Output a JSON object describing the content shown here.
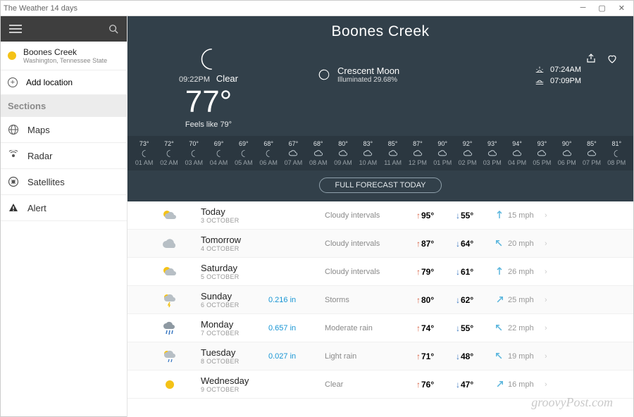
{
  "window": {
    "title": "The Weather 14 days"
  },
  "sidebar": {
    "location": {
      "name": "Boones Creek",
      "region": "Washington, Tennessee State"
    },
    "add_label": "Add location",
    "sections_header": "Sections",
    "items": [
      {
        "label": "Maps",
        "icon": "globe"
      },
      {
        "label": "Radar",
        "icon": "radar"
      },
      {
        "label": "Satellites",
        "icon": "sat"
      },
      {
        "label": "Alert",
        "icon": "alert"
      }
    ]
  },
  "hero": {
    "city": "Boones Creek",
    "time": "09:22PM",
    "condition": "Clear",
    "temp": "77°",
    "feels": "Feels like 79°",
    "moon": {
      "name": "Crescent Moon",
      "illum": "Illuminated 29.68%"
    },
    "sunrise": "07:24AM",
    "sunset": "07:09PM",
    "full_forecast_label": "FULL FORECAST TODAY"
  },
  "hourly": [
    {
      "temp": "73°",
      "icon": "moon",
      "time": "01 AM"
    },
    {
      "temp": "72°",
      "icon": "moon",
      "time": "02 AM"
    },
    {
      "temp": "70°",
      "icon": "moon",
      "time": "03 AM"
    },
    {
      "temp": "69°",
      "icon": "moon",
      "time": "04 AM"
    },
    {
      "temp": "69°",
      "icon": "moon",
      "time": "05 AM"
    },
    {
      "temp": "68°",
      "icon": "moon",
      "time": "06 AM"
    },
    {
      "temp": "67°",
      "icon": "cloud",
      "time": "07 AM"
    },
    {
      "temp": "68°",
      "icon": "cloud",
      "time": "08 AM"
    },
    {
      "temp": "80°",
      "icon": "cloud",
      "time": "09 AM"
    },
    {
      "temp": "83°",
      "icon": "cloud",
      "time": "10 AM"
    },
    {
      "temp": "85°",
      "icon": "cloud",
      "time": "11 AM"
    },
    {
      "temp": "87°",
      "icon": "cloud",
      "time": "12 PM"
    },
    {
      "temp": "90°",
      "icon": "cloud",
      "time": "01 PM"
    },
    {
      "temp": "92°",
      "icon": "cloud",
      "time": "02 PM"
    },
    {
      "temp": "93°",
      "icon": "cloud",
      "time": "03 PM"
    },
    {
      "temp": "94°",
      "icon": "cloud",
      "time": "04 PM"
    },
    {
      "temp": "93°",
      "icon": "cloud",
      "time": "05 PM"
    },
    {
      "temp": "90°",
      "icon": "cloud",
      "time": "06 PM"
    },
    {
      "temp": "85°",
      "icon": "cloud",
      "time": "07 PM"
    },
    {
      "temp": "81°",
      "icon": "moon",
      "time": "08 PM"
    }
  ],
  "daily": [
    {
      "icon": "partly",
      "name": "Today",
      "date": "3 OCTOBER",
      "precip": "",
      "cond": "Cloudy intervals",
      "hi": "95°",
      "lo": "55°",
      "wind": "15 mph",
      "wdir": "N"
    },
    {
      "icon": "cloud",
      "name": "Tomorrow",
      "date": "4 OCTOBER",
      "precip": "",
      "cond": "Cloudy intervals",
      "hi": "87°",
      "lo": "64°",
      "wind": "20 mph",
      "wdir": "NW"
    },
    {
      "icon": "partly",
      "name": "Saturday",
      "date": "5 OCTOBER",
      "precip": "",
      "cond": "Cloudy intervals",
      "hi": "79°",
      "lo": "61°",
      "wind": "26 mph",
      "wdir": "N"
    },
    {
      "icon": "storm",
      "name": "Sunday",
      "date": "6 OCTOBER",
      "precip": "0.216 in",
      "cond": "Storms",
      "hi": "80°",
      "lo": "62°",
      "wind": "25 mph",
      "wdir": "NE"
    },
    {
      "icon": "rain",
      "name": "Monday",
      "date": "7 OCTOBER",
      "precip": "0.657 in",
      "cond": "Moderate rain",
      "hi": "74°",
      "lo": "55°",
      "wind": "22 mph",
      "wdir": "NW"
    },
    {
      "icon": "lrain",
      "name": "Tuesday",
      "date": "8 OCTOBER",
      "precip": "0.027 in",
      "cond": "Light rain",
      "hi": "71°",
      "lo": "48°",
      "wind": "19 mph",
      "wdir": "NW"
    },
    {
      "icon": "sun",
      "name": "Wednesday",
      "date": "9 OCTOBER",
      "precip": "",
      "cond": "Clear",
      "hi": "76°",
      "lo": "47°",
      "wind": "16 mph",
      "wdir": "NE"
    }
  ],
  "watermark": "groovyPost.com"
}
